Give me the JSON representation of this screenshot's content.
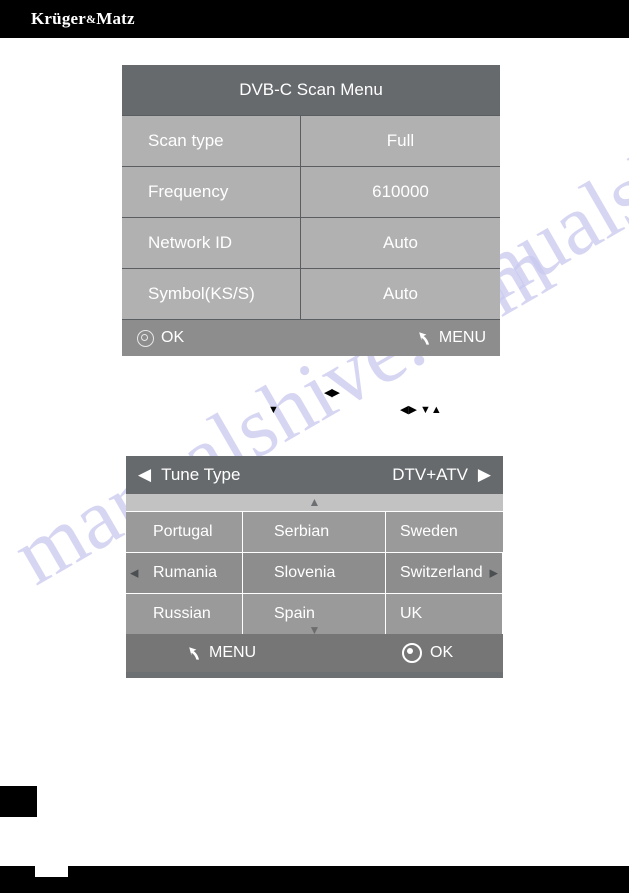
{
  "page": {
    "brand": "Krüger",
    "brand_amp": "&",
    "brand_tail": "Matz",
    "watermark_line1": "manualshive.com",
    "watermark_line2": "manualshive.com"
  },
  "scan_menu": {
    "title": "DVB-C Scan Menu",
    "rows": [
      {
        "label": "Scan type",
        "value": "Full"
      },
      {
        "label": "Frequency",
        "value": "610000"
      },
      {
        "label": "Network ID",
        "value": "Auto"
      },
      {
        "label": "Symbol(KS/S)",
        "value": "Auto"
      }
    ],
    "footer": {
      "ok_label": "OK",
      "ok_icon": "ok-ring-icon",
      "menu_label": "MENU",
      "menu_icon": "back-arrow-icon"
    }
  },
  "stray_glyphs": {
    "a": "▼",
    "b": "◀▶",
    "c": "◀▶ ▼▲"
  },
  "tune_menu": {
    "header": {
      "left_caret": "◀",
      "label": "Tune Type",
      "value": "DTV+ATV",
      "right_caret": "▶"
    },
    "scroll_up_caret": "▲",
    "scroll_down_caret": "▼",
    "row_caret_left": "◀",
    "row_caret_right": "▶",
    "selected_row_index": 1,
    "country_rows": [
      [
        "Portugal",
        "Serbian",
        "Sweden"
      ],
      [
        "Rumania",
        "Slovenia",
        "Switzerland"
      ],
      [
        "Russian",
        "Spain",
        "UK"
      ]
    ],
    "footer": {
      "menu_label": "MENU",
      "menu_icon": "back-arrow-icon",
      "ok_label": "OK",
      "ok_icon": "ok-dot-icon"
    }
  },
  "colors": {
    "panel_header": "#666a6d",
    "row_light": "#b1b1b1",
    "row_mid": "#9a9a9a",
    "footer_gray": "#8d8d8d",
    "black": "#000000",
    "white": "#ffffff",
    "watermark": "#c9c9ef"
  }
}
